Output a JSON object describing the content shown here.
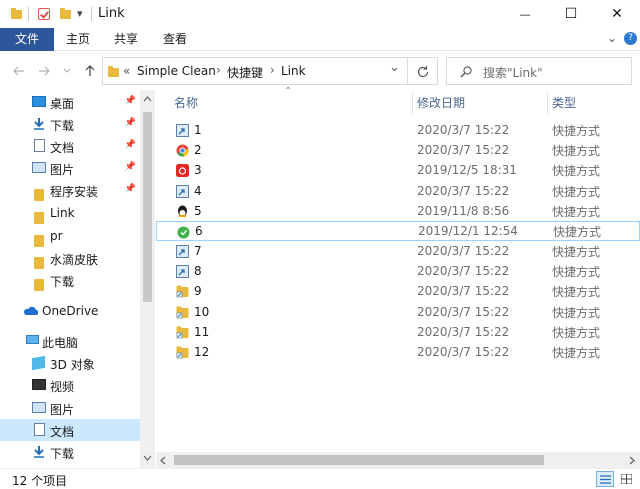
{
  "window": {
    "title": "Link",
    "qa_dropdown": "▾",
    "controls": {
      "minimize": "—",
      "maximize": "☐",
      "close": "✕"
    }
  },
  "ribbon": {
    "tabs": [
      "文件",
      "主页",
      "共享",
      "查看"
    ],
    "expand_glyph": "⌄",
    "help_glyph": "?"
  },
  "address": {
    "overflow": "«",
    "path": [
      "Simple Clean",
      "快捷键",
      "Link"
    ],
    "sep": "›",
    "dropdown": "⌄",
    "search_placeholder": "搜索\"Link\""
  },
  "nav": {
    "quick_access": [
      {
        "label": "桌面",
        "icon": "desktop-icon",
        "pinned": true
      },
      {
        "label": "下载",
        "icon": "download-icon",
        "pinned": true
      },
      {
        "label": "文档",
        "icon": "document-icon",
        "pinned": true
      },
      {
        "label": "图片",
        "icon": "picture-icon",
        "pinned": true
      },
      {
        "label": "程序安装",
        "icon": "folder-icon",
        "pinned": true
      },
      {
        "label": "Link",
        "icon": "folder-icon",
        "pinned": false
      },
      {
        "label": "pr",
        "icon": "folder-icon",
        "pinned": false
      },
      {
        "label": "水滴皮肤",
        "icon": "folder-icon",
        "pinned": false
      },
      {
        "label": "下载",
        "icon": "folder-icon",
        "pinned": false
      }
    ],
    "onedrive": "OneDrive",
    "this_pc": "此电脑",
    "pc_items": [
      {
        "label": "3D 对象",
        "icon": "3d-objects-icon"
      },
      {
        "label": "视频",
        "icon": "video-icon"
      },
      {
        "label": "图片",
        "icon": "picture-icon"
      },
      {
        "label": "文档",
        "icon": "document-icon"
      },
      {
        "label": "下载",
        "icon": "download-icon"
      }
    ]
  },
  "columns": {
    "name": "名称",
    "date": "修改日期",
    "type": "类型",
    "sort_glyph": "⌃"
  },
  "files": [
    {
      "name": "1",
      "date": "2020/3/7 15:22",
      "type": "快捷方式",
      "icon": "shortcut-app-icon"
    },
    {
      "name": "2",
      "date": "2020/3/7 15:22",
      "type": "快捷方式",
      "icon": "chrome-icon"
    },
    {
      "name": "3",
      "date": "2019/12/5 18:31",
      "type": "快捷方式",
      "icon": "netease-music-icon"
    },
    {
      "name": "4",
      "date": "2020/3/7 15:22",
      "type": "快捷方式",
      "icon": "shortcut-app-icon"
    },
    {
      "name": "5",
      "date": "2019/11/8 8:56",
      "type": "快捷方式",
      "icon": "qq-icon"
    },
    {
      "name": "6",
      "date": "2019/12/1 12:54",
      "type": "快捷方式",
      "icon": "green-app-icon"
    },
    {
      "name": "7",
      "date": "2020/3/7 15:22",
      "type": "快捷方式",
      "icon": "shortcut-app-icon"
    },
    {
      "name": "8",
      "date": "2020/3/7 15:22",
      "type": "快捷方式",
      "icon": "shortcut-app-icon"
    },
    {
      "name": "9",
      "date": "2020/3/7 15:22",
      "type": "快捷方式",
      "icon": "folder-shortcut-icon"
    },
    {
      "name": "10",
      "date": "2020/3/7 15:22",
      "type": "快捷方式",
      "icon": "folder-shortcut-icon"
    },
    {
      "name": "11",
      "date": "2020/3/7 15:22",
      "type": "快捷方式",
      "icon": "folder-shortcut-icon"
    },
    {
      "name": "12",
      "date": "2020/3/7 15:22",
      "type": "快捷方式",
      "icon": "folder-shortcut-icon"
    }
  ],
  "status": {
    "count": "12 个项目"
  },
  "colors": {
    "file_tab": "#2b579a",
    "folder": "#e8b93a",
    "selected_nav": "#cce8ff",
    "hover_row": "#99d1ff",
    "header_text": "#4a6690"
  }
}
